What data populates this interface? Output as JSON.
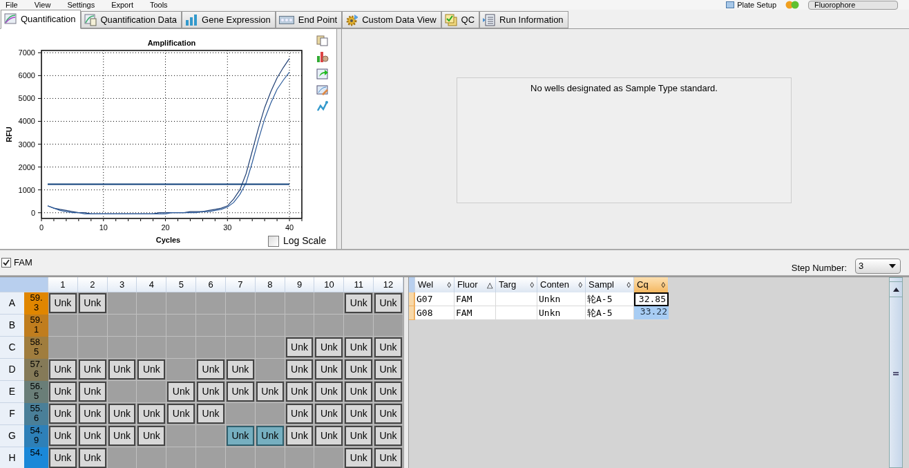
{
  "menu": [
    "File",
    "View",
    "Settings",
    "Export",
    "Tools"
  ],
  "toolbar": {
    "plate_setup": "Plate Setup",
    "fluorophore": "Fluorophore"
  },
  "tabs": [
    {
      "label": "Quantification",
      "kind": "curve",
      "selected": true
    },
    {
      "label": "Quantification Data",
      "kind": "curvedoc",
      "selected": false
    },
    {
      "label": "Gene Expression",
      "kind": "bars",
      "selected": false
    },
    {
      "label": "End Point",
      "kind": "dots",
      "selected": false
    },
    {
      "label": "Custom Data View",
      "kind": "gear",
      "selected": false
    },
    {
      "label": "QC",
      "kind": "check",
      "selected": false
    },
    {
      "label": "Run Information",
      "kind": "doc",
      "selected": false
    }
  ],
  "amplification": {
    "log_scale": {
      "label": "Log Scale",
      "checked": false
    },
    "chart_data": {
      "type": "line",
      "title": "Amplification",
      "xlabel": "Cycles",
      "ylabel": "RFU",
      "grid": true,
      "xlim": [
        0,
        42
      ],
      "ylim": [
        -250,
        7100
      ],
      "xticks": [
        0,
        10,
        20,
        30,
        40
      ],
      "yticks": [
        0,
        1000,
        2000,
        3000,
        4000,
        5000,
        6000,
        7000
      ],
      "x": [
        1,
        2,
        3,
        4,
        5,
        6,
        7,
        8,
        9,
        10,
        11,
        12,
        13,
        14,
        15,
        16,
        17,
        18,
        19,
        20,
        21,
        22,
        23,
        24,
        25,
        26,
        27,
        28,
        29,
        30,
        31,
        32,
        33,
        34,
        35,
        36,
        37,
        38,
        39,
        40
      ],
      "series": [
        {
          "color": "#1f3f73",
          "values": [
            300,
            200,
            150,
            100,
            50,
            0,
            0,
            -50,
            -50,
            -50,
            -50,
            -50,
            -50,
            -50,
            -50,
            -50,
            -50,
            -50,
            0,
            0,
            0,
            0,
            0,
            50,
            50,
            50,
            100,
            150,
            200,
            300,
            600,
            1000,
            1700,
            2700,
            3700,
            4600,
            5300,
            5900,
            6350,
            6750
          ]
        },
        {
          "color": "#2b5a9a",
          "values": [
            300,
            200,
            100,
            50,
            0,
            0,
            -50,
            -50,
            -50,
            -50,
            -50,
            -50,
            -50,
            -50,
            -50,
            -50,
            -50,
            -50,
            -50,
            -50,
            0,
            0,
            0,
            0,
            0,
            50,
            50,
            100,
            150,
            250,
            450,
            800,
            1300,
            2200,
            3200,
            4100,
            4800,
            5400,
            5800,
            6150
          ]
        },
        {
          "color": "#0b3d78",
          "values": [
            1250,
            1250,
            1250,
            1250,
            1250,
            1250,
            1250,
            1250,
            1250,
            1250,
            1250,
            1250,
            1250,
            1250,
            1250,
            1250,
            1250,
            1250,
            1250,
            1250,
            1250,
            1250,
            1250,
            1250,
            1250,
            1250,
            1250,
            1250,
            1250,
            1250,
            1250,
            1250,
            1250,
            1250,
            1250,
            1250,
            1250,
            1250,
            1250,
            1250
          ]
        }
      ]
    }
  },
  "standard_curve": {
    "message": "No wells designated as Sample Type standard."
  },
  "fluor_filter": {
    "label": "FAM",
    "checked": true
  },
  "step": {
    "label": "Step Number:",
    "value": "3"
  },
  "plate": {
    "columns": [
      "1",
      "2",
      "3",
      "4",
      "5",
      "6",
      "7",
      "8",
      "9",
      "10",
      "11",
      "12"
    ],
    "rows": [
      {
        "label": "A",
        "temp": "59.\n3",
        "color": "#e08600",
        "wells": [
          {
            "kind": "sample",
            "content": "Unk",
            "selected": false
          },
          {
            "kind": "sample",
            "content": "Unk",
            "selected": false
          },
          {
            "kind": "empty"
          },
          {
            "kind": "empty"
          },
          {
            "kind": "empty"
          },
          {
            "kind": "empty"
          },
          {
            "kind": "empty"
          },
          {
            "kind": "empty"
          },
          {
            "kind": "empty"
          },
          {
            "kind": "empty"
          },
          {
            "kind": "sample",
            "content": "Unk",
            "selected": false
          },
          {
            "kind": "sample",
            "content": "Unk",
            "selected": false
          }
        ]
      },
      {
        "label": "B",
        "temp": "59.\n1",
        "color": "#c07d1e",
        "wells": [
          {
            "kind": "empty"
          },
          {
            "kind": "empty"
          },
          {
            "kind": "empty"
          },
          {
            "kind": "empty"
          },
          {
            "kind": "empty"
          },
          {
            "kind": "empty"
          },
          {
            "kind": "empty"
          },
          {
            "kind": "empty"
          },
          {
            "kind": "empty"
          },
          {
            "kind": "empty"
          },
          {
            "kind": "empty"
          },
          {
            "kind": "empty"
          }
        ]
      },
      {
        "label": "C",
        "temp": "58.\n5",
        "color": "#a07d3e",
        "wells": [
          {
            "kind": "empty"
          },
          {
            "kind": "empty"
          },
          {
            "kind": "empty"
          },
          {
            "kind": "empty"
          },
          {
            "kind": "empty"
          },
          {
            "kind": "empty"
          },
          {
            "kind": "empty"
          },
          {
            "kind": "empty"
          },
          {
            "kind": "sample",
            "content": "Unk",
            "selected": false
          },
          {
            "kind": "sample",
            "content": "Unk",
            "selected": false
          },
          {
            "kind": "sample",
            "content": "Unk",
            "selected": false
          },
          {
            "kind": "sample",
            "content": "Unk",
            "selected": false
          }
        ]
      },
      {
        "label": "D",
        "temp": "57.\n6",
        "color": "#857a58",
        "wells": [
          {
            "kind": "sample",
            "content": "Unk",
            "selected": false
          },
          {
            "kind": "sample",
            "content": "Unk",
            "selected": false
          },
          {
            "kind": "sample",
            "content": "Unk",
            "selected": false
          },
          {
            "kind": "sample",
            "content": "Unk",
            "selected": false
          },
          {
            "kind": "empty"
          },
          {
            "kind": "sample",
            "content": "Unk",
            "selected": false
          },
          {
            "kind": "sample",
            "content": "Unk",
            "selected": false
          },
          {
            "kind": "empty"
          },
          {
            "kind": "sample",
            "content": "Unk",
            "selected": false
          },
          {
            "kind": "sample",
            "content": "Unk",
            "selected": false
          },
          {
            "kind": "sample",
            "content": "Unk",
            "selected": false
          },
          {
            "kind": "sample",
            "content": "Unk",
            "selected": false
          }
        ]
      },
      {
        "label": "E",
        "temp": "56.\n5",
        "color": "#6a7e78",
        "wells": [
          {
            "kind": "sample",
            "content": "Unk",
            "selected": false
          },
          {
            "kind": "sample",
            "content": "Unk",
            "selected": false
          },
          {
            "kind": "empty"
          },
          {
            "kind": "empty"
          },
          {
            "kind": "sample",
            "content": "Unk",
            "selected": false
          },
          {
            "kind": "sample",
            "content": "Unk",
            "selected": false
          },
          {
            "kind": "sample",
            "content": "Unk",
            "selected": false
          },
          {
            "kind": "sample",
            "content": "Unk",
            "selected": false
          },
          {
            "kind": "sample",
            "content": "Unk",
            "selected": false
          },
          {
            "kind": "sample",
            "content": "Unk",
            "selected": false
          },
          {
            "kind": "sample",
            "content": "Unk",
            "selected": false
          },
          {
            "kind": "sample",
            "content": "Unk",
            "selected": false
          }
        ]
      },
      {
        "label": "F",
        "temp": "55.\n6",
        "color": "#4a7f98",
        "wells": [
          {
            "kind": "sample",
            "content": "Unk",
            "selected": false
          },
          {
            "kind": "sample",
            "content": "Unk",
            "selected": false
          },
          {
            "kind": "sample",
            "content": "Unk",
            "selected": false
          },
          {
            "kind": "sample",
            "content": "Unk",
            "selected": false
          },
          {
            "kind": "sample",
            "content": "Unk",
            "selected": false
          },
          {
            "kind": "sample",
            "content": "Unk",
            "selected": false
          },
          {
            "kind": "empty"
          },
          {
            "kind": "empty"
          },
          {
            "kind": "sample",
            "content": "Unk",
            "selected": false
          },
          {
            "kind": "sample",
            "content": "Unk",
            "selected": false
          },
          {
            "kind": "sample",
            "content": "Unk",
            "selected": false
          },
          {
            "kind": "sample",
            "content": "Unk",
            "selected": false
          }
        ]
      },
      {
        "label": "G",
        "temp": "54.\n9",
        "color": "#2e80b8",
        "wells": [
          {
            "kind": "sample",
            "content": "Unk",
            "selected": false
          },
          {
            "kind": "sample",
            "content": "Unk",
            "selected": false
          },
          {
            "kind": "sample",
            "content": "Unk",
            "selected": false
          },
          {
            "kind": "sample",
            "content": "Unk",
            "selected": false
          },
          {
            "kind": "empty"
          },
          {
            "kind": "empty"
          },
          {
            "kind": "sample",
            "content": "Unk",
            "selected": true
          },
          {
            "kind": "sample",
            "content": "Unk",
            "selected": true
          },
          {
            "kind": "sample",
            "content": "Unk",
            "selected": false
          },
          {
            "kind": "sample",
            "content": "Unk",
            "selected": false
          },
          {
            "kind": "sample",
            "content": "Unk",
            "selected": false
          },
          {
            "kind": "sample",
            "content": "Unk",
            "selected": false
          }
        ]
      },
      {
        "label": "H",
        "temp": "54.",
        "color": "#1a88d8",
        "wells": [
          {
            "kind": "sample",
            "content": "Unk",
            "selected": false
          },
          {
            "kind": "sample",
            "content": "Unk",
            "selected": false
          },
          {
            "kind": "empty"
          },
          {
            "kind": "empty"
          },
          {
            "kind": "empty"
          },
          {
            "kind": "empty"
          },
          {
            "kind": "empty"
          },
          {
            "kind": "empty"
          },
          {
            "kind": "empty"
          },
          {
            "kind": "empty"
          },
          {
            "kind": "sample",
            "content": "Unk",
            "selected": false
          },
          {
            "kind": "sample",
            "content": "Unk",
            "selected": false
          }
        ]
      }
    ]
  },
  "results": {
    "columns": [
      {
        "label": "Wel",
        "sort": "◊"
      },
      {
        "label": "Fluor",
        "sort": "△"
      },
      {
        "label": "Targ",
        "sort": "◊"
      },
      {
        "label": "Conten",
        "sort": "◊"
      },
      {
        "label": "Sampl",
        "sort": "◊"
      },
      {
        "label": "Cq",
        "sort": "◊",
        "selected": true
      }
    ],
    "rows": [
      {
        "well": "G07",
        "fluor": "FAM",
        "content": "Unkn",
        "sample": "轮A-5",
        "cq": "32.85",
        "cq_focused": true
      },
      {
        "well": "G08",
        "fluor": "FAM",
        "content": "Unkn",
        "sample": "轮A-5",
        "cq": "33.22",
        "cq_focused": false
      }
    ]
  }
}
